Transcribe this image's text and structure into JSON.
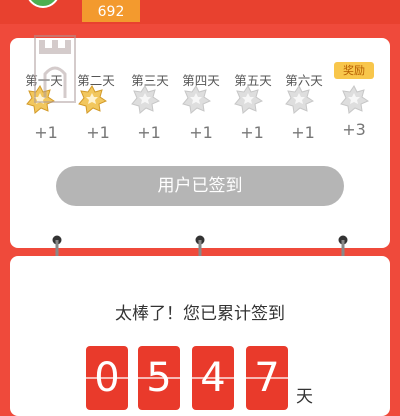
{
  "header": {
    "score": "692"
  },
  "checkin": {
    "days": [
      "第一天",
      "第二天",
      "第三天",
      "第四天",
      "第五天",
      "第六天"
    ],
    "reward_label": "奖励",
    "points": [
      "+1",
      "+1",
      "+1",
      "+1",
      "+1",
      "+1",
      "+3"
    ],
    "signed_button": "用户已签到"
  },
  "summary": {
    "message": "太棒了！您已累计签到",
    "digits": [
      "0",
      "5",
      "4",
      "7"
    ],
    "unit": "天"
  },
  "colors": {
    "background": "#ef4a3b",
    "accent": "#e93a2b",
    "badge": "#f39a2e",
    "reward": "#f8c64b"
  }
}
